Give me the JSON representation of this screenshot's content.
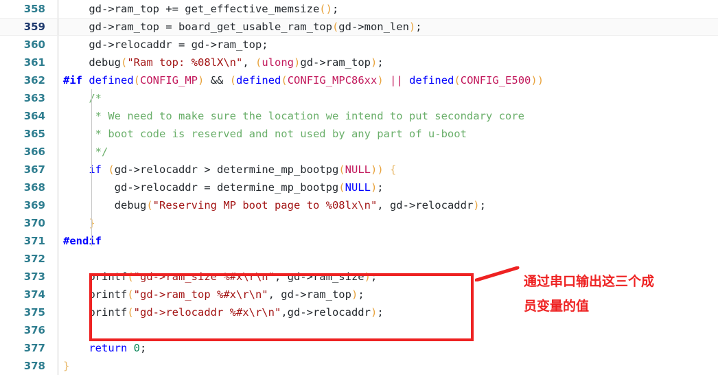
{
  "editor": {
    "language": "c",
    "current_line": 359,
    "first_line": 358,
    "last_line": 378,
    "colors": {
      "background": "#ffffff",
      "line_number": "#2e7d8f",
      "line_number_active": "#1f3a6e",
      "keyword": "#0000ff",
      "preprocessor": "#0000ff",
      "string": "#a31515",
      "comment": "#6aaf6a",
      "paren": "#e8a33d",
      "macro": "#c2185b",
      "number": "#098658",
      "plain": "#24292e",
      "annotation": "#ee2222"
    }
  },
  "lines": [
    {
      "number": "358",
      "current": false,
      "tokens": [
        {
          "t": "    ",
          "c": "t-plain"
        },
        {
          "t": "gd->ram_top += get_effective_memsize",
          "c": "t-plain"
        },
        {
          "t": "()",
          "c": "t-paren"
        },
        {
          "t": ";",
          "c": "t-punct"
        }
      ]
    },
    {
      "number": "359",
      "current": true,
      "tokens": [
        {
          "t": "    ",
          "c": "t-plain"
        },
        {
          "t": "gd->ram_top = board_get_usable_ram_top",
          "c": "t-plain"
        },
        {
          "t": "(",
          "c": "t-paren"
        },
        {
          "t": "gd->mon_len",
          "c": "t-plain"
        },
        {
          "t": ")",
          "c": "t-paren"
        },
        {
          "t": ";",
          "c": "t-punct"
        }
      ]
    },
    {
      "number": "360",
      "current": false,
      "tokens": [
        {
          "t": "    ",
          "c": "t-plain"
        },
        {
          "t": "gd->relocaddr = gd->ram_top;",
          "c": "t-plain"
        }
      ]
    },
    {
      "number": "361",
      "current": false,
      "tokens": [
        {
          "t": "    ",
          "c": "t-plain"
        },
        {
          "t": "debug",
          "c": "t-plain"
        },
        {
          "t": "(",
          "c": "t-paren"
        },
        {
          "t": "\"Ram top: %08lX\\n\"",
          "c": "t-str"
        },
        {
          "t": ", ",
          "c": "t-punct"
        },
        {
          "t": "(",
          "c": "t-paren"
        },
        {
          "t": "ulong",
          "c": "t-type"
        },
        {
          "t": ")",
          "c": "t-paren"
        },
        {
          "t": "gd->ram_top",
          "c": "t-plain"
        },
        {
          "t": ")",
          "c": "t-paren"
        },
        {
          "t": ";",
          "c": "t-punct"
        }
      ]
    },
    {
      "number": "362",
      "current": false,
      "tokens": [
        {
          "t": "#if",
          "c": "t-pre"
        },
        {
          "t": " ",
          "c": "t-plain"
        },
        {
          "t": "defined",
          "c": "t-kw"
        },
        {
          "t": "(",
          "c": "t-paren"
        },
        {
          "t": "CONFIG_MP",
          "c": "t-macro"
        },
        {
          "t": ")",
          "c": "t-paren"
        },
        {
          "t": " && ",
          "c": "t-plain"
        },
        {
          "t": "(",
          "c": "t-paren"
        },
        {
          "t": "defined",
          "c": "t-kw"
        },
        {
          "t": "(",
          "c": "t-paren"
        },
        {
          "t": "CONFIG_MPC86xx",
          "c": "t-macro"
        },
        {
          "t": ")",
          "c": "t-paren"
        },
        {
          "t": " ",
          "c": "t-plain"
        },
        {
          "t": "||",
          "c": "t-macro"
        },
        {
          "t": " ",
          "c": "t-plain"
        },
        {
          "t": "defined",
          "c": "t-kw"
        },
        {
          "t": "(",
          "c": "t-paren"
        },
        {
          "t": "CONFIG_E500",
          "c": "t-macro"
        },
        {
          "t": "))",
          "c": "t-paren"
        }
      ]
    },
    {
      "number": "363",
      "current": false,
      "tokens": [
        {
          "t": "    ",
          "c": "t-plain"
        },
        {
          "t": "/*",
          "c": "t-comment"
        }
      ]
    },
    {
      "number": "364",
      "current": false,
      "tokens": [
        {
          "t": "     ",
          "c": "t-plain"
        },
        {
          "t": "* We need to make sure the location we intend to put secondary core",
          "c": "t-comment"
        }
      ]
    },
    {
      "number": "365",
      "current": false,
      "tokens": [
        {
          "t": "     ",
          "c": "t-plain"
        },
        {
          "t": "* boot code is reserved and not used by any part of u-boot",
          "c": "t-comment"
        }
      ]
    },
    {
      "number": "366",
      "current": false,
      "tokens": [
        {
          "t": "     ",
          "c": "t-plain"
        },
        {
          "t": "*/",
          "c": "t-comment"
        }
      ]
    },
    {
      "number": "367",
      "current": false,
      "tokens": [
        {
          "t": "    ",
          "c": "t-plain"
        },
        {
          "t": "if",
          "c": "t-kw"
        },
        {
          "t": " ",
          "c": "t-plain"
        },
        {
          "t": "(",
          "c": "t-paren"
        },
        {
          "t": "gd->relocaddr > determine_mp_bootpg",
          "c": "t-plain"
        },
        {
          "t": "(",
          "c": "t-paren"
        },
        {
          "t": "NULL",
          "c": "t-macro"
        },
        {
          "t": "))",
          "c": "t-paren"
        },
        {
          "t": " ",
          "c": "t-plain"
        },
        {
          "t": "{",
          "c": "t-brace"
        }
      ]
    },
    {
      "number": "368",
      "current": false,
      "tokens": [
        {
          "t": "        ",
          "c": "t-plain"
        },
        {
          "t": "gd->relocaddr = determine_mp_bootpg",
          "c": "t-plain"
        },
        {
          "t": "(",
          "c": "t-paren"
        },
        {
          "t": "NULL",
          "c": "t-kw"
        },
        {
          "t": ")",
          "c": "t-paren"
        },
        {
          "t": ";",
          "c": "t-punct"
        }
      ]
    },
    {
      "number": "369",
      "current": false,
      "tokens": [
        {
          "t": "        ",
          "c": "t-plain"
        },
        {
          "t": "debug",
          "c": "t-plain"
        },
        {
          "t": "(",
          "c": "t-paren"
        },
        {
          "t": "\"Reserving MP boot page to %08lx\\n\"",
          "c": "t-str"
        },
        {
          "t": ", gd->relocaddr",
          "c": "t-plain"
        },
        {
          "t": ")",
          "c": "t-paren"
        },
        {
          "t": ";",
          "c": "t-punct"
        }
      ]
    },
    {
      "number": "370",
      "current": false,
      "tokens": [
        {
          "t": "    ",
          "c": "t-plain"
        },
        {
          "t": "}",
          "c": "t-brace"
        }
      ]
    },
    {
      "number": "371",
      "current": false,
      "tokens": [
        {
          "t": "#endif",
          "c": "t-pre"
        }
      ]
    },
    {
      "number": "372",
      "current": false,
      "tokens": []
    },
    {
      "number": "373",
      "current": false,
      "tokens": [
        {
          "t": "    ",
          "c": "t-plain"
        },
        {
          "t": "printf",
          "c": "t-fn"
        },
        {
          "t": "(",
          "c": "t-paren"
        },
        {
          "t": "\"gd->ram_size %#x\\r\\n\"",
          "c": "t-str"
        },
        {
          "t": ", gd->ram_size",
          "c": "t-plain"
        },
        {
          "t": ")",
          "c": "t-paren"
        },
        {
          "t": ";",
          "c": "t-punct"
        }
      ]
    },
    {
      "number": "374",
      "current": false,
      "tokens": [
        {
          "t": "    ",
          "c": "t-plain"
        },
        {
          "t": "printf",
          "c": "t-fn"
        },
        {
          "t": "(",
          "c": "t-paren"
        },
        {
          "t": "\"gd->ram_top %#x\\r\\n\"",
          "c": "t-str"
        },
        {
          "t": ", gd->ram_top",
          "c": "t-plain"
        },
        {
          "t": ")",
          "c": "t-paren"
        },
        {
          "t": ";",
          "c": "t-punct"
        }
      ]
    },
    {
      "number": "375",
      "current": false,
      "tokens": [
        {
          "t": "    ",
          "c": "t-plain"
        },
        {
          "t": "printf",
          "c": "t-fn"
        },
        {
          "t": "(",
          "c": "t-paren"
        },
        {
          "t": "\"gd->relocaddr %#x\\r\\n\"",
          "c": "t-str"
        },
        {
          "t": ",gd->relocaddr",
          "c": "t-plain"
        },
        {
          "t": ")",
          "c": "t-paren"
        },
        {
          "t": ";",
          "c": "t-punct"
        }
      ]
    },
    {
      "number": "376",
      "current": false,
      "tokens": []
    },
    {
      "number": "377",
      "current": false,
      "tokens": [
        {
          "t": "    ",
          "c": "t-plain"
        },
        {
          "t": "return",
          "c": "t-kw"
        },
        {
          "t": " ",
          "c": "t-plain"
        },
        {
          "t": "0",
          "c": "t-num"
        },
        {
          "t": ";",
          "c": "t-punct"
        }
      ]
    },
    {
      "number": "378",
      "current": false,
      "tokens": [
        {
          "t": "}",
          "c": "t-brace"
        }
      ]
    }
  ],
  "annotation": {
    "color": "#ee2222",
    "line1": "通过串口输出这三个成",
    "line2": "员变量的值",
    "highlight_lines": [
      "373",
      "374",
      "375"
    ]
  }
}
